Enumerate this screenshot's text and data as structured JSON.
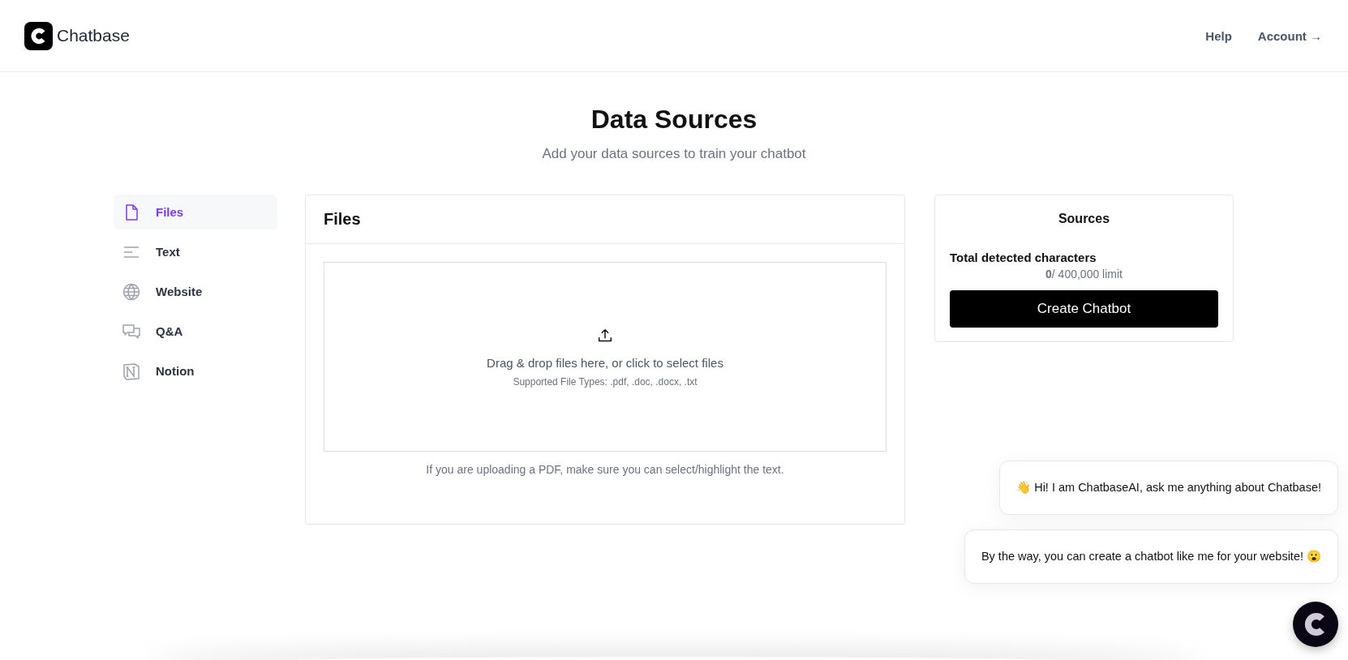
{
  "header": {
    "brand": "Chatbase",
    "nav": [
      "Help",
      "Account →"
    ]
  },
  "page": {
    "title": "Data Sources",
    "subtitle": "Add your data sources to train your chatbot"
  },
  "sidebar": {
    "items": [
      {
        "label": "Files",
        "kind": "file",
        "selected": true
      },
      {
        "label": "Text",
        "kind": "text",
        "selected": false
      },
      {
        "label": "Website",
        "kind": "globe",
        "selected": false
      },
      {
        "label": "Q&A",
        "kind": "chat",
        "selected": false
      },
      {
        "label": "Notion",
        "kind": "notion",
        "selected": false
      }
    ]
  },
  "files_panel": {
    "title": "Files",
    "dropzone": {
      "prompt": "Drag & drop files here, or click to select files",
      "types": "Supported File Types: .pdf, .doc, .docx, .txt"
    },
    "note": "If you are uploading a PDF, make sure you can select/highlight the text."
  },
  "sources": {
    "title": "Sources",
    "label": "Total detected characters",
    "count": "**0**/ 400,000 limit",
    "button": "Create Chatbot"
  },
  "chat_widget": {
    "messages": [
      "👋 Hi! I am ChatbaseAI, ask me anything about Chatbase!",
      "By the way, you can create a chatbot like me for your website! 😮"
    ]
  }
}
